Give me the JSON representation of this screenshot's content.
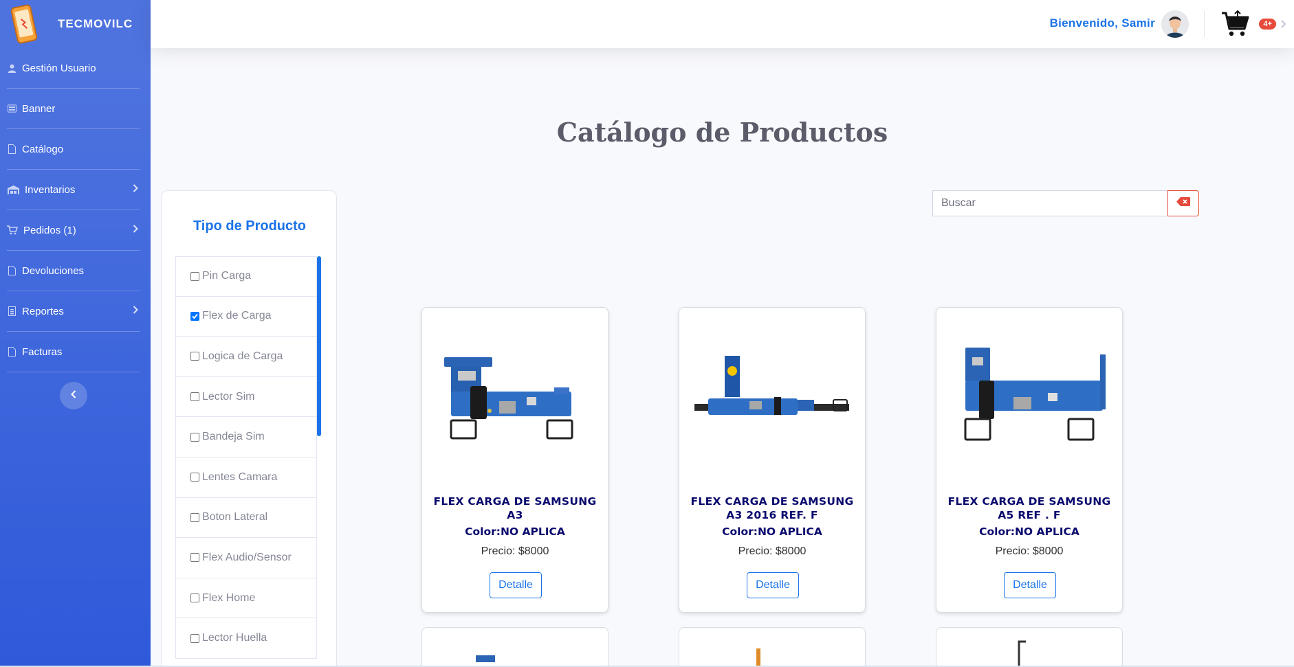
{
  "brand": {
    "name": "TECMOVILC",
    "logo_icon": "phone-logo-icon"
  },
  "sidebar": {
    "items": [
      {
        "label": "Gestión Usuario",
        "icon": "user-icon",
        "has_submenu": false
      },
      {
        "label": "Banner",
        "icon": "banner-icon",
        "has_submenu": false
      },
      {
        "label": "Catálogo",
        "icon": "file-icon",
        "has_submenu": false
      },
      {
        "label": "Inventarios",
        "icon": "warehouse-icon",
        "has_submenu": true
      },
      {
        "label": "Pedidos (1)",
        "icon": "cart-icon",
        "has_submenu": true
      },
      {
        "label": "Devoluciones",
        "icon": "file-icon",
        "has_submenu": false
      },
      {
        "label": "Reportes",
        "icon": "report-icon",
        "has_submenu": true
      },
      {
        "label": "Facturas",
        "icon": "file-icon",
        "has_submenu": false
      }
    ]
  },
  "topbar": {
    "welcome": "Bienvenido, Samir",
    "cart_badge": "4+"
  },
  "main": {
    "title": "Catálogo de Productos",
    "search": {
      "placeholder": "Buscar",
      "value": ""
    }
  },
  "filters": {
    "title": "Tipo de Producto",
    "items": [
      {
        "label": "Pin Carga",
        "checked": false
      },
      {
        "label": "Flex de Carga",
        "checked": true
      },
      {
        "label": "Logica de Carga",
        "checked": false
      },
      {
        "label": "Lector Sim",
        "checked": false
      },
      {
        "label": "Bandeja Sim",
        "checked": false
      },
      {
        "label": "Lentes Camara",
        "checked": false
      },
      {
        "label": "Boton Lateral",
        "checked": false
      },
      {
        "label": "Flex Audio/Sensor",
        "checked": false
      },
      {
        "label": "Flex Home",
        "checked": false
      },
      {
        "label": "Lector Huella",
        "checked": false
      }
    ]
  },
  "products": [
    {
      "name_line1": "FLEX CARGA DE SAMSUNG",
      "name_line2": "A3",
      "color": "Color:NO APLICA",
      "price": "Precio: $8000",
      "button": "Detalle"
    },
    {
      "name_line1": "FLEX CARGA DE SAMSUNG",
      "name_line2": "A3 2016 REF. F",
      "color": "Color:NO APLICA",
      "price": "Precio: $8000",
      "button": "Detalle"
    },
    {
      "name_line1": "FLEX CARGA DE SAMSUNG",
      "name_line2": "A5 REF . F",
      "color": "Color:NO APLICA",
      "price": "Precio: $8000",
      "button": "Detalle"
    }
  ],
  "colors": {
    "accent": "#1a73e8",
    "sidebar": "#4e73df",
    "danger": "#e74a3b",
    "product_text": "#0a0a6e"
  }
}
